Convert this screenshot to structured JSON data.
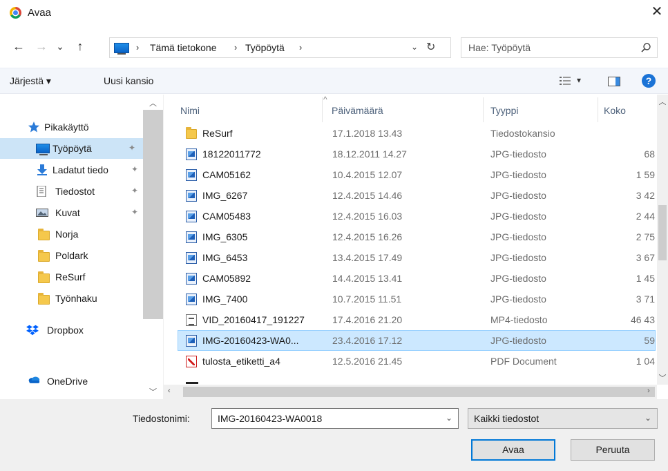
{
  "window": {
    "title": "Avaa",
    "close_glyph": "✕"
  },
  "nav_buttons": {
    "back": "←",
    "forward": "→",
    "recent": "⌄",
    "up": "↑"
  },
  "address": {
    "crumbs": [
      "Tämä tietokone",
      "Työpöytä"
    ],
    "separator": "›",
    "dropdown_glyph": "⌄",
    "refresh_glyph": "↻"
  },
  "search": {
    "placeholder": "Hae: Työpöytä"
  },
  "toolbar": {
    "organize_label": "Järjestä ▾",
    "new_folder_label": "Uusi kansio",
    "view_dropdown": "▾",
    "help_label": "?"
  },
  "sidebar": {
    "items": [
      {
        "label": "Pikakäyttö",
        "icon": "star-icon"
      },
      {
        "label": "Työpöytä",
        "icon": "desktop-icon",
        "pinned": true,
        "selected": true
      },
      {
        "label": "Ladatut tiedo",
        "icon": "download-icon",
        "pinned": true
      },
      {
        "label": "Tiedostot",
        "icon": "documents-icon",
        "pinned": true
      },
      {
        "label": "Kuvat",
        "icon": "pictures-icon",
        "pinned": true
      },
      {
        "label": "Norja",
        "icon": "folder-icon"
      },
      {
        "label": "Poldark",
        "icon": "folder-icon"
      },
      {
        "label": "ReSurf",
        "icon": "folder-icon"
      },
      {
        "label": "Työnhaku",
        "icon": "folder-icon"
      },
      {
        "label": "Dropbox",
        "icon": "dropbox-icon"
      },
      {
        "label": "OneDrive",
        "icon": "onedrive-icon"
      }
    ],
    "pin_glyph": "📌"
  },
  "filelist": {
    "columns": {
      "name": "Nimi",
      "date": "Päivämäärä",
      "type": "Tyyppi",
      "size": "Koko"
    },
    "sort_glyph": "^",
    "rows": [
      {
        "name": "ReSurf",
        "date": "17.1.2018 13.43",
        "type": "Tiedostokansio",
        "size": "",
        "icon": "folder-icon"
      },
      {
        "name": "18122011772",
        "date": "18.12.2011 14.27",
        "type": "JPG-tiedosto",
        "size": "68",
        "icon": "jpg-icon"
      },
      {
        "name": "CAM05162",
        "date": "10.4.2015 12.07",
        "type": "JPG-tiedosto",
        "size": "1 59",
        "icon": "jpg-icon"
      },
      {
        "name": "IMG_6267",
        "date": "12.4.2015 14.46",
        "type": "JPG-tiedosto",
        "size": "3 42",
        "icon": "jpg-icon"
      },
      {
        "name": "CAM05483",
        "date": "12.4.2015 16.03",
        "type": "JPG-tiedosto",
        "size": "2 44",
        "icon": "jpg-icon"
      },
      {
        "name": "IMG_6305",
        "date": "12.4.2015 16.26",
        "type": "JPG-tiedosto",
        "size": "2 75",
        "icon": "jpg-icon"
      },
      {
        "name": "IMG_6453",
        "date": "13.4.2015 17.49",
        "type": "JPG-tiedosto",
        "size": "3 67",
        "icon": "jpg-icon"
      },
      {
        "name": "CAM05892",
        "date": "14.4.2015 13.41",
        "type": "JPG-tiedosto",
        "size": "1 45",
        "icon": "jpg-icon"
      },
      {
        "name": "IMG_7400",
        "date": "10.7.2015 11.51",
        "type": "JPG-tiedosto",
        "size": "3 71",
        "icon": "jpg-icon"
      },
      {
        "name": "VID_20160417_191227",
        "date": "17.4.2016 21.20",
        "type": "MP4-tiedosto",
        "size": "46 43",
        "icon": "video-file-icon"
      },
      {
        "name": "IMG-20160423-WA0...",
        "date": "23.4.2016 17.12",
        "type": "JPG-tiedosto",
        "size": "59",
        "icon": "jpg-icon",
        "selected": true
      },
      {
        "name": "tulosta_etiketti_a4",
        "date": "12.5.2016 21.45",
        "type": "PDF Document",
        "size": "1 04",
        "icon": "pdf-icon"
      }
    ]
  },
  "bottom": {
    "filename_label": "Tiedostonimi:",
    "filename_value": "IMG-20160423-WA0018",
    "filter_value": "Kaikki tiedostot",
    "open_label": "Avaa",
    "cancel_label": "Peruuta",
    "dropdown_glyph": "⌄"
  },
  "colors": {
    "selection": "#cce8ff",
    "nav_selection": "#cce4f7",
    "accent": "#0078d7"
  }
}
